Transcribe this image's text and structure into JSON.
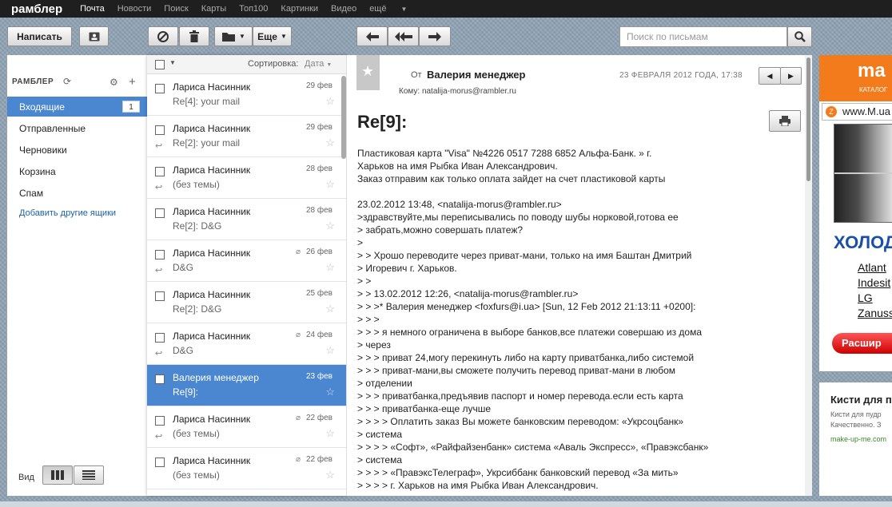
{
  "topbar": {
    "logo": "рамблер",
    "nav": [
      "Почта",
      "Новости",
      "Поиск",
      "Карты",
      "Топ100",
      "Картинки",
      "Видео",
      "ещё"
    ]
  },
  "toolbar": {
    "compose": "Написать",
    "more": "Еще",
    "search_placeholder": "Поиск по письмам"
  },
  "sidebar": {
    "header": "РАМБЛЕР",
    "folders": [
      {
        "label": "Входящие",
        "count": "1"
      },
      {
        "label": "Отправленные"
      },
      {
        "label": "Черновики"
      },
      {
        "label": "Корзина"
      },
      {
        "label": "Спам"
      }
    ],
    "add_boxes": "Добавить другие ящики",
    "view_label": "Вид"
  },
  "list": {
    "sort_label": "Сортировка:",
    "sort_value": "Дата",
    "messages": [
      {
        "sender": "Лариса Насинник",
        "subject": "Re[4]: your mail",
        "date": "29 фев"
      },
      {
        "sender": "Лариса Насинник",
        "subject": "Re[2]: your mail",
        "date": "29 фев"
      },
      {
        "sender": "Лариса Насинник",
        "subject": "(без темы)",
        "date": "28 фев"
      },
      {
        "sender": "Лариса Насинник",
        "subject": "Re[2]: D&G",
        "date": "28 фев"
      },
      {
        "sender": "Лариса Насинник",
        "subject": "D&G",
        "date": "26 фев"
      },
      {
        "sender": "Лариса Насинник",
        "subject": "Re[2]: D&G",
        "date": "25 фев"
      },
      {
        "sender": "Лариса Насинник",
        "subject": "D&G",
        "date": "24 фев"
      },
      {
        "sender": "Валерия менеджер",
        "subject": "Re[9]:",
        "date": "23 фев"
      },
      {
        "sender": "Лариса Насинник",
        "subject": "(без темы)",
        "date": "22 фев"
      },
      {
        "sender": "Лариса Насинник",
        "subject": "(без темы)",
        "date": "22 фев"
      }
    ]
  },
  "message": {
    "from_label": "От",
    "from_name": "Валерия менеджер",
    "to_label": "Кому:",
    "to_email": "natalija-morus@rambler.ru",
    "date": "23 ФЕВРАЛЯ 2012 ГОДА, 17:38",
    "subject": "Re[9]:",
    "body_lines": [
      "Пластиковая карта \"Visa\" №4226 0517 7288 6852 Альфа-Банк. » г.",
      "Харьков на имя Рыбка Иван Александрович.",
      "Заказ отправим как только оплата зайдет на счет пластиковой карты",
      "",
      "23.02.2012 13:48, <natalija-morus@rambler.ru>",
      ">здравствуйте,мы переписывались по поводу шубы норковой,готова ее",
      "> забрать,можно совершать платеж?",
      ">",
      "> > Хрошо переводите через приват-мани, только на имя Баштан Дмитрий",
      "> Игоревич г. Харьков.",
      "> >",
      "> > 13.02.2012 12:26, <natalija-morus@rambler.ru>",
      "> > >* Валерия менеджер <foxfurs@i.ua> [Sun, 12 Feb 2012 21:13:11 +0200]:",
      "> > >",
      "> > > я немного ограничена в выборе банков,все платежи совершаю из дома",
      "> через",
      "> > > приват 24,могу перекинуть либо на карту приватбанка,либо системой",
      "> > > приват-мани,вы сможете получить перевод приват-мани в любом",
      "> отделении",
      "> > > приватбанка,предъявив паспорт и номер перевода.если есть карта",
      "> > > приватбанка-еще лучше",
      "> > > > Оплатить заказ Вы можете банковским переводом: «Укрсоцбанк»",
      "> система",
      "> > > > «Софт», «Райфайзенбанк» система «Аваль Экспресс», «Правэксбанк»",
      "> система",
      "> > > > «ПравэксТелеграф», Укрсиббанк банковский перевод «За мить»",
      "> > > > г. Харьков на имя Рыбка Иван Александрович."
    ]
  },
  "ads": {
    "top_title": "ma",
    "top_caption": "КАТАЛОГ",
    "url": "www.M.ua",
    "heading": "ХОЛОД",
    "brands": [
      "Atlant",
      "Indesit",
      "LG",
      "Zanuss"
    ],
    "button": "Расшир",
    "box_title": "Кисти для п",
    "box_line1": "Кисти для пудр",
    "box_line2": "Качественно. З",
    "box_url": "make-up-me.com"
  }
}
